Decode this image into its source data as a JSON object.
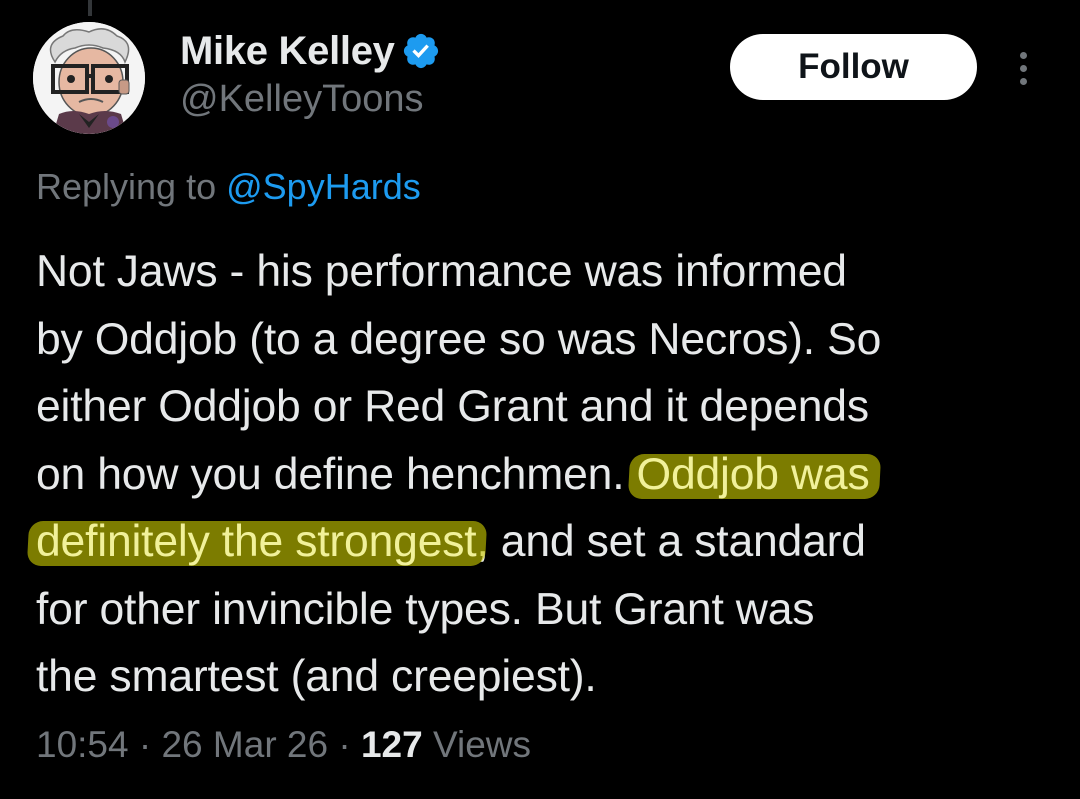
{
  "author": {
    "display_name": "Mike Kelley",
    "handle": "@KelleyToons",
    "verified": true,
    "avatar_icon": "cartoon-old-man-avatar"
  },
  "actions": {
    "follow_label": "Follow",
    "more_icon": "more-vertical-icon"
  },
  "reply": {
    "prefix": "Replying to",
    "mention": "@SpyHards"
  },
  "tweet": {
    "lines": [
      "Not Jaws - his performance was informed",
      "by Oddjob (to a degree so was Necros). So",
      "either Oddjob or Red Grant and it depends",
      "on how you define henchmen. ",
      "Oddjob was",
      "definitely the strongest",
      ", and set a standard",
      "for other invincible types. But Grant was",
      "the smartest (and creepiest)."
    ],
    "highlighted_text": "Oddjob was definitely the strongest"
  },
  "meta": {
    "time": "10:54",
    "separator": "·",
    "date": "26 Mar 26",
    "views_count": "127",
    "views_label": "Views"
  },
  "colors": {
    "background": "#000000",
    "text_primary": "#e7e9ea",
    "text_secondary": "#71767b",
    "link": "#1d9bf0",
    "verified": "#1d9bf0",
    "highlight": "#c8c800",
    "follow_bg": "#ffffff"
  }
}
